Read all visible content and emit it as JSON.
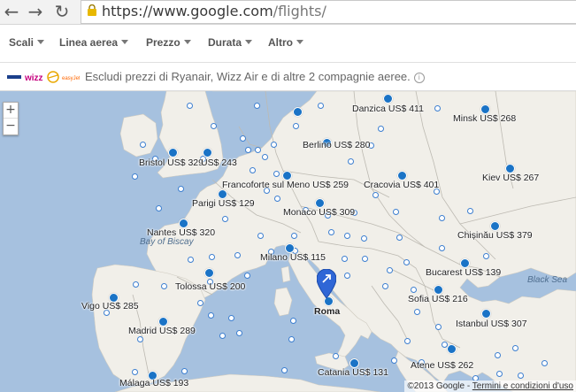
{
  "browser": {
    "url_host": "https://www.google.com",
    "url_path": "/flights/"
  },
  "filters": [
    "Scali",
    "Linea aerea",
    "Prezzo",
    "Durata",
    "Altro"
  ],
  "info_bar": {
    "text": "Escludi prezzi di Ryanair, Wizz Air e di altre 2 compagnie aeree.",
    "icon": "info-icon",
    "airline_logos": [
      "ryanair-logo",
      "wizz-logo",
      "lufthansa-logo",
      "easyjet-logo"
    ]
  },
  "map": {
    "zoom_in": "+",
    "zoom_out": "−",
    "origin": "Roma",
    "seas": [
      "Bay of Biscay",
      "Black Sea"
    ],
    "cities": [
      {
        "name": "Danzica",
        "price": "US$ 411"
      },
      {
        "name": "Minsk",
        "price": "US$ 268"
      },
      {
        "name": "Berlino",
        "price": "US$ 280"
      },
      {
        "name": "Bristol",
        "price": "US$ 329"
      },
      {
        "name": "",
        "price": "US$ 243"
      },
      {
        "name": "Francoforte sul Meno",
        "price": "US$ 259"
      },
      {
        "name": "Cracovia",
        "price": "US$ 401"
      },
      {
        "name": "Kiev",
        "price": "US$ 267"
      },
      {
        "name": "Parigi",
        "price": "US$ 129"
      },
      {
        "name": "Monaco",
        "price": "US$ 309"
      },
      {
        "name": "Nantes",
        "price": "US$ 320"
      },
      {
        "name": "Chișinău",
        "price": "US$ 379"
      },
      {
        "name": "Milano",
        "price": "US$ 115"
      },
      {
        "name": "Bucarest",
        "price": "US$ 139"
      },
      {
        "name": "Tolossa",
        "price": "US$ 200"
      },
      {
        "name": "Vigo",
        "price": "US$ 285"
      },
      {
        "name": "Sofia",
        "price": "US$ 216"
      },
      {
        "name": "Madrid",
        "price": "US$ 289"
      },
      {
        "name": "Istanbul",
        "price": "US$ 307"
      },
      {
        "name": "Atene",
        "price": "US$ 262"
      },
      {
        "name": "Catania",
        "price": "US$ 131"
      },
      {
        "name": "Málaga",
        "price": "US$ 193"
      }
    ],
    "copyright": "©2013 Google - ",
    "terms": "Termini e condizioni d'uso"
  },
  "colors": {
    "sea": "#a6c1df",
    "land": "#f1efe9",
    "border": "#bdbab2",
    "dot": "#1a73c6",
    "pin": "#2f66d6"
  }
}
